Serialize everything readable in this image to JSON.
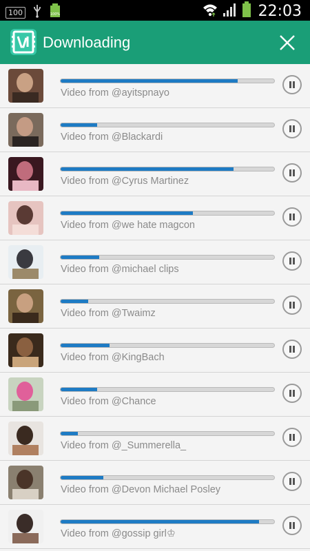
{
  "status_bar": {
    "badge": "100",
    "battery_label": "100%",
    "time": "22:03"
  },
  "app_bar": {
    "title": "Downloading",
    "accent_color": "#1a9e77"
  },
  "downloads": [
    {
      "label": "Video from @ayitspnayo",
      "progress": 0.83,
      "thumb_colors": [
        "#6b4a3a",
        "#c9a184",
        "#3a2a22"
      ]
    },
    {
      "label": "Video from @Blackardi",
      "progress": 0.17,
      "thumb_colors": [
        "#7a6a5c",
        "#c49b84",
        "#2b2422"
      ]
    },
    {
      "label": "Video from @Cyrus Martinez",
      "progress": 0.81,
      "thumb_colors": [
        "#3a1820",
        "#c06c7c",
        "#e8b8c4"
      ]
    },
    {
      "label": "Video from @we hate magcon",
      "progress": 0.62,
      "thumb_colors": [
        "#e6c4c0",
        "#5a3a34",
        "#f4ddd8"
      ]
    },
    {
      "label": "Video from @michael clips",
      "progress": 0.18,
      "thumb_colors": [
        "#e8eef2",
        "#3a3a40",
        "#9c8a6a"
      ]
    },
    {
      "label": "Video from @Twaimz",
      "progress": 0.13,
      "thumb_colors": [
        "#7a6440",
        "#c8a080",
        "#3a2a1c"
      ]
    },
    {
      "label": "Video from @KingBach",
      "progress": 0.23,
      "thumb_colors": [
        "#3a2a1c",
        "#8a6040",
        "#c9a47a"
      ]
    },
    {
      "label": "Video from @Chance",
      "progress": 0.17,
      "thumb_colors": [
        "#c8d4c0",
        "#e0609a",
        "#8a9a7a"
      ]
    },
    {
      "label": "Video from @_Summerella_",
      "progress": 0.08,
      "thumb_colors": [
        "#e8e4e0",
        "#3a2a20",
        "#b08060"
      ]
    },
    {
      "label": "Video from @Devon Michael Posley",
      "progress": 0.2,
      "thumb_colors": [
        "#8a8070",
        "#4a3428",
        "#d8d0c4"
      ]
    },
    {
      "label": "Video from @gossip girl♔",
      "progress": 0.93,
      "thumb_colors": [
        "#f0f0f0",
        "#3a2c28",
        "#8a6a5a"
      ]
    }
  ]
}
